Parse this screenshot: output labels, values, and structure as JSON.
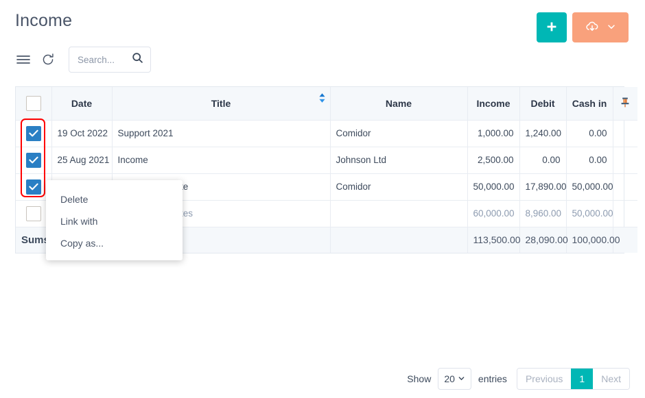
{
  "header": {
    "title": "Income",
    "add_button_label": "+",
    "add_icon": "plus-icon",
    "export_icon": "cloud-download-icon",
    "export_caret_icon": "chevron-down-icon"
  },
  "toolbar": {
    "menu_icon": "hamburger-menu-icon",
    "refresh_icon": "refresh-icon",
    "search_placeholder": "Search...",
    "search_value": "",
    "search_icon": "search-icon"
  },
  "table": {
    "columns": [
      {
        "key": "checkbox",
        "label": ""
      },
      {
        "key": "date",
        "label": "Date"
      },
      {
        "key": "title",
        "label": "Title"
      },
      {
        "key": "name",
        "label": "Name"
      },
      {
        "key": "income",
        "label": "Income"
      },
      {
        "key": "debit",
        "label": "Debit"
      },
      {
        "key": "cash_in",
        "label": "Cash in"
      },
      {
        "key": "pin",
        "label": ""
      }
    ],
    "header_checkbox_checked": false,
    "title_sort_icon": "sort-updown-icon",
    "pin_icon": "pushpin-icon",
    "rows": [
      {
        "selected": true,
        "date": "19 Oct 2022",
        "title": "Support 2021",
        "name": "Comidor",
        "income": "1,000.00",
        "debit": "1,240.00",
        "cash_in": "0.00",
        "muted": false
      },
      {
        "selected": true,
        "date": "25 Aug 2021",
        "title": "Income",
        "name": "Johnson Ltd",
        "income": "2,500.00",
        "debit": "0.00",
        "cash_in": "0.00",
        "muted": false
      },
      {
        "selected": true,
        "date": "",
        "title": "Project Aphrodite",
        "name": "Comidor",
        "income": "50,000.00",
        "debit": "17,890.00",
        "cash_in": "50,000.00",
        "muted": false
      },
      {
        "selected": false,
        "date": "",
        "title": "Project Aphrodites",
        "name": "",
        "income": "60,000.00",
        "debit": "8,960.00",
        "cash_in": "50,000.00",
        "muted": true
      }
    ],
    "sums": {
      "label": "Sums",
      "income": "113,500.00",
      "debit": "28,090.00",
      "cash_in": "100,000.00"
    }
  },
  "context_menu": {
    "items": [
      {
        "label": "Delete"
      },
      {
        "label": "Link with"
      },
      {
        "label": "Copy as..."
      }
    ]
  },
  "footer": {
    "show_label": "Show",
    "entries_value": "20",
    "entries_label": "entries",
    "previous_label": "Previous",
    "current_page": "1",
    "next_label": "Next",
    "caret_icon": "chevron-down-icon"
  },
  "colors": {
    "accent_teal": "#00b7b5",
    "accent_orange": "#f9a17c",
    "checkbox_blue": "#2a7fc4",
    "annotation_red": "#ff0000",
    "header_bg": "#f5f8fb"
  }
}
